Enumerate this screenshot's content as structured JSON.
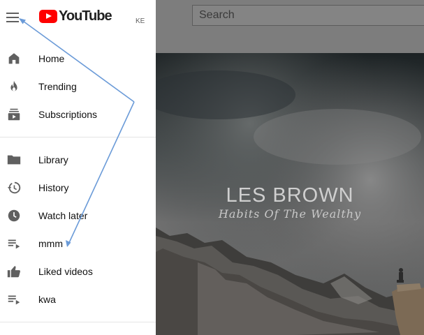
{
  "header": {
    "logo_text": "YouTube",
    "country_code": "KE",
    "search_placeholder": "Search"
  },
  "sidebar": {
    "items": [
      {
        "label": "Home",
        "icon": "home-icon"
      },
      {
        "label": "Trending",
        "icon": "trending-icon"
      },
      {
        "label": "Subscriptions",
        "icon": "subscriptions-icon"
      },
      {
        "label": "Library",
        "icon": "library-icon"
      },
      {
        "label": "History",
        "icon": "history-icon"
      },
      {
        "label": "Watch later",
        "icon": "watch-later-icon"
      },
      {
        "label": "mmm",
        "icon": "playlist-icon"
      },
      {
        "label": "Liked videos",
        "icon": "liked-videos-icon"
      },
      {
        "label": "kwa",
        "icon": "playlist-icon"
      }
    ]
  },
  "hero": {
    "title": "LES BROWN",
    "subtitle": "Habits Of The Wealthy"
  },
  "colors": {
    "brand_red": "#ff0000",
    "annotation_arrow": "#6b9bd8",
    "overlay_dim": "#7d7d7d"
  }
}
